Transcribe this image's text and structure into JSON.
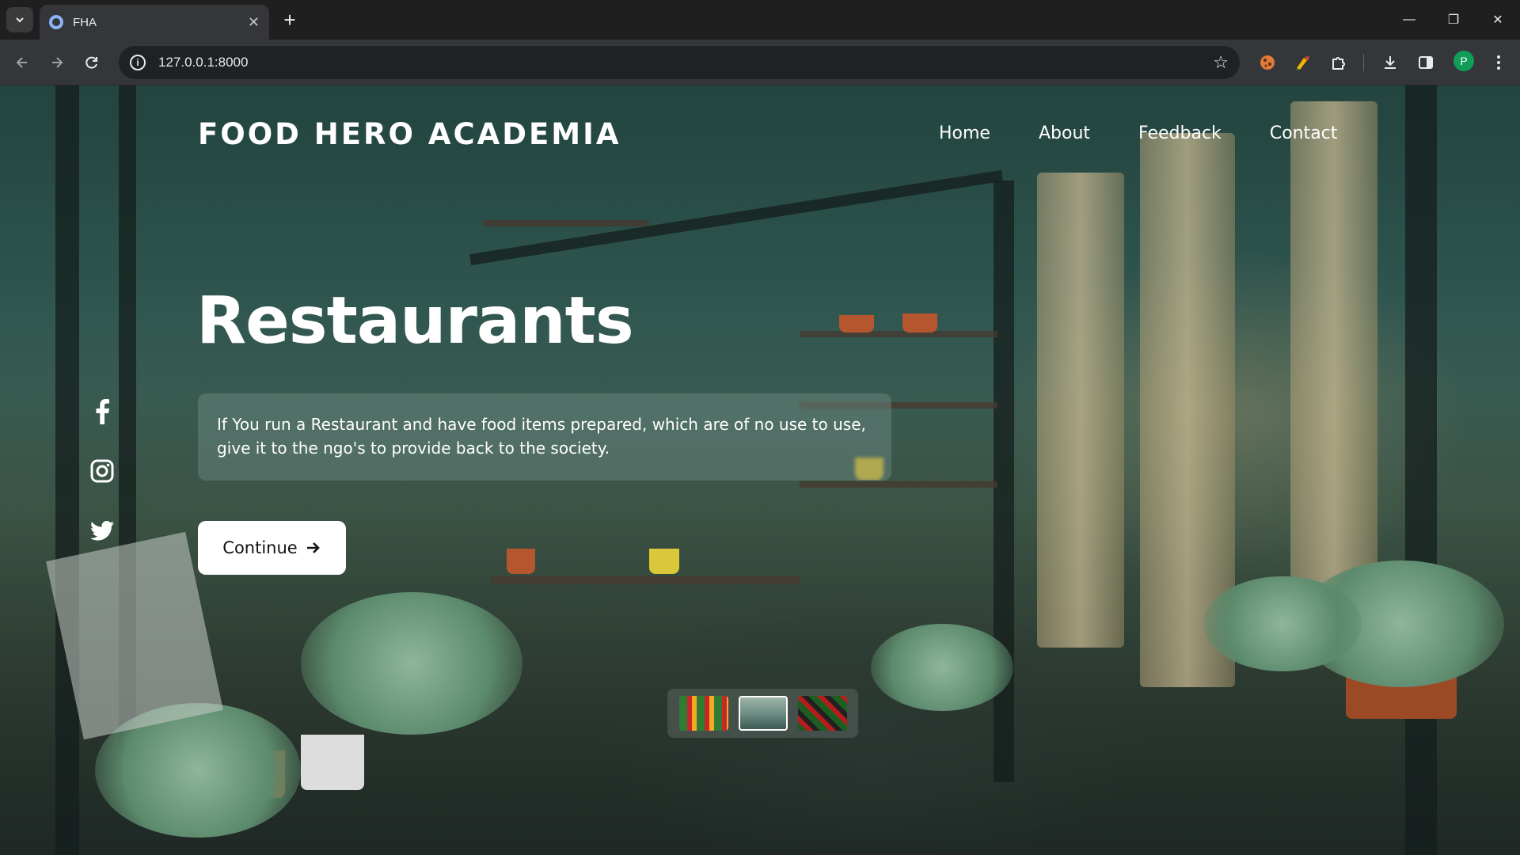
{
  "browser": {
    "tab_title": "FHA",
    "url": "127.0.0.1:8000",
    "profile_initial": "P"
  },
  "page": {
    "brand": "FOOD HERO ACADEMIA",
    "nav": [
      "Home",
      "About",
      "Feedback",
      "Contact"
    ],
    "headline": "Restaurants",
    "description": "If You run a Restaurant and have food items prepared, which are of no use to use, give it to the ngo's to provide back to the society.",
    "cta_label": "Continue",
    "social": [
      "facebook-icon",
      "instagram-icon",
      "twitter-icon"
    ],
    "thumbnails": [
      {
        "name": "thumbnail-1",
        "active": false,
        "colors": [
          "#2e7d32",
          "#c62828",
          "#f9a825"
        ]
      },
      {
        "name": "thumbnail-2",
        "active": true,
        "colors": [
          "#6e8f86",
          "#3d5a52",
          "#9fb3a8"
        ]
      },
      {
        "name": "thumbnail-3",
        "active": false,
        "colors": [
          "#1b5e20",
          "#b71c1c",
          "#212121"
        ]
      }
    ]
  }
}
